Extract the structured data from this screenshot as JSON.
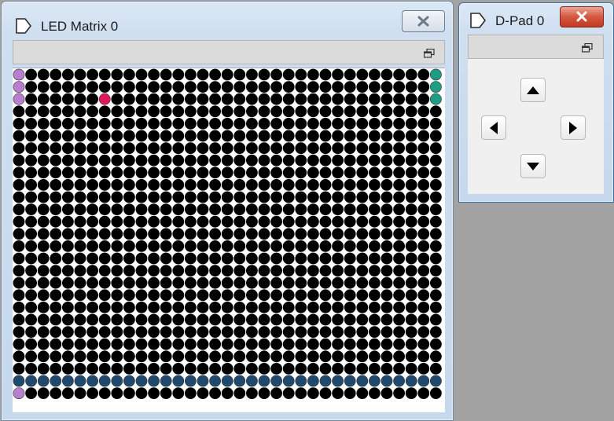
{
  "led_window": {
    "title": "LED Matrix 0",
    "icon": "led-matrix-window-icon",
    "close_label": "✕",
    "restore_icon": "restore-window-icon"
  },
  "matrix": {
    "rows": 27,
    "cols": 35,
    "off_color": "#000000",
    "lit": [
      {
        "row": 0,
        "col": 0,
        "color": "#b77fce"
      },
      {
        "row": 1,
        "col": 0,
        "color": "#b77fce"
      },
      {
        "row": 2,
        "col": 0,
        "color": "#b77fce"
      },
      {
        "row": 0,
        "col": 34,
        "color": "#1e9c84"
      },
      {
        "row": 1,
        "col": 34,
        "color": "#1e9c84"
      },
      {
        "row": 2,
        "col": 34,
        "color": "#1e9c84"
      },
      {
        "row": 2,
        "col": 7,
        "color": "#e0185a"
      },
      {
        "row": 26,
        "col": 0,
        "color": "#b77fce"
      }
    ],
    "lit_rows": [
      {
        "row": 25,
        "color": "#1f4a6e"
      }
    ]
  },
  "dpad_window": {
    "title": "D-Pad 0",
    "icon": "dpad-window-icon",
    "close_label": "✕",
    "restore_icon": "restore-window-icon",
    "buttons": [
      "up",
      "left",
      "right",
      "down"
    ]
  }
}
